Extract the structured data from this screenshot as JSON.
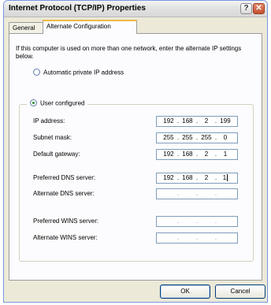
{
  "window": {
    "title": "Internet Protocol (TCP/IP) Properties",
    "help_glyph": "?",
    "close_glyph": "✕"
  },
  "tabs": [
    {
      "label": "General",
      "active": false
    },
    {
      "label": "Alternate Configuration",
      "active": true
    }
  ],
  "intro": "If this computer is used on more than one network, enter the alternate IP settings below.",
  "options": {
    "automatic_label": "Automatic private IP address",
    "user_label": "User configured",
    "selected": "user"
  },
  "fields": {
    "ip": {
      "label": "IP address:",
      "octets": [
        "192",
        "168",
        "2",
        "199"
      ]
    },
    "subnet": {
      "label": "Subnet mask:",
      "octets": [
        "255",
        "255",
        "255",
        "0"
      ]
    },
    "gateway": {
      "label": "Default gateway:",
      "octets": [
        "192",
        "168",
        "2",
        "1"
      ]
    },
    "pref_dns": {
      "label": "Preferred DNS server:",
      "octets": [
        "192",
        "168",
        "2",
        "1"
      ]
    },
    "alt_dns": {
      "label": "Alternate DNS server:",
      "octets": [
        "",
        "",
        "",
        ""
      ]
    },
    "pref_wins": {
      "label": "Preferred WINS server:",
      "octets": [
        "",
        "",
        "",
        ""
      ]
    },
    "alt_wins": {
      "label": "Alternate WINS server:",
      "octets": [
        "",
        "",
        "",
        ""
      ]
    }
  },
  "buttons": {
    "ok": "OK",
    "cancel": "Cancel"
  }
}
